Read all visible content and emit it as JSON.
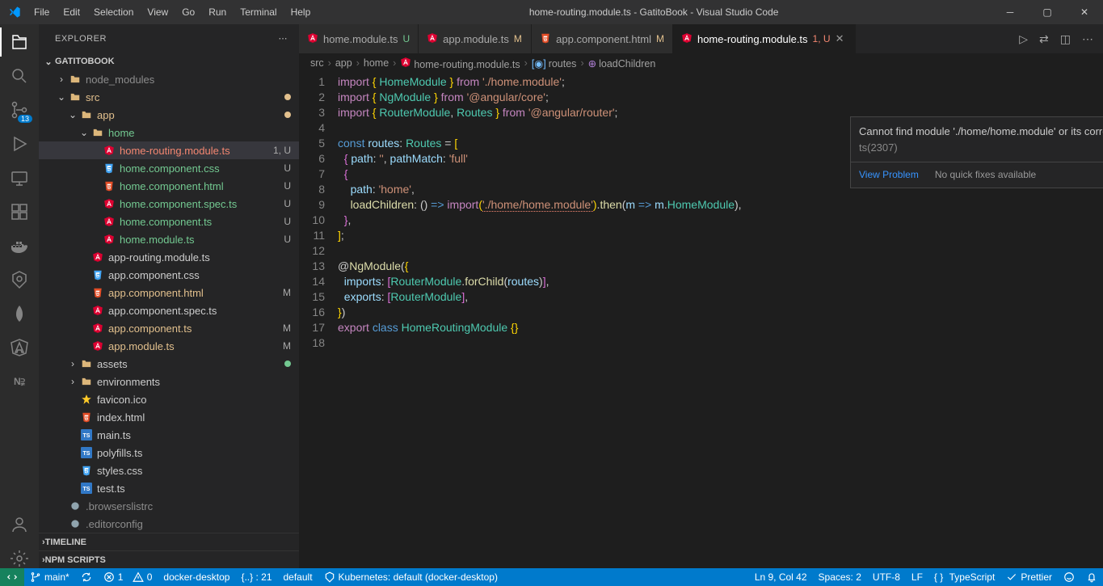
{
  "window": {
    "title": "home-routing.module.ts - GatitoBook - Visual Studio Code",
    "menu": [
      "File",
      "Edit",
      "Selection",
      "View",
      "Go",
      "Run",
      "Terminal",
      "Help"
    ]
  },
  "activity": {
    "scm_badge": "13"
  },
  "sidebar": {
    "header": "EXPLORER",
    "root": "GATITOBOOK",
    "footer1": "TIMELINE",
    "footer2": "NPM SCRIPTS",
    "tree": [
      {
        "indent": 1,
        "twisty": ">",
        "folder": true,
        "label": "node_modules",
        "class": "c-ign"
      },
      {
        "indent": 1,
        "twisty": "v",
        "folder": true,
        "label": "src",
        "class": "c-mod",
        "dot": "#e2c08d"
      },
      {
        "indent": 2,
        "twisty": "v",
        "folder": true,
        "label": "app",
        "class": "c-mod",
        "dot": "#e2c08d"
      },
      {
        "indent": 3,
        "twisty": "v",
        "folder": true,
        "label": "home",
        "class": "c-unt"
      },
      {
        "indent": 4,
        "icon": "ang",
        "label": "home-routing.module.ts",
        "class": "c-err",
        "badge": "1, U",
        "selected": true
      },
      {
        "indent": 4,
        "icon": "css",
        "label": "home.component.css",
        "class": "c-unt",
        "badge": "U"
      },
      {
        "indent": 4,
        "icon": "html",
        "label": "home.component.html",
        "class": "c-unt",
        "badge": "U"
      },
      {
        "indent": 4,
        "icon": "ang",
        "label": "home.component.spec.ts",
        "class": "c-unt",
        "badge": "U"
      },
      {
        "indent": 4,
        "icon": "ang",
        "label": "home.component.ts",
        "class": "c-unt",
        "badge": "U"
      },
      {
        "indent": 4,
        "icon": "ang",
        "label": "home.module.ts",
        "class": "c-unt",
        "badge": "U"
      },
      {
        "indent": 3,
        "icon": "ang",
        "label": "app-routing.module.ts"
      },
      {
        "indent": 3,
        "icon": "css",
        "label": "app.component.css"
      },
      {
        "indent": 3,
        "icon": "html",
        "label": "app.component.html",
        "class": "c-mod",
        "badge": "M"
      },
      {
        "indent": 3,
        "icon": "ang",
        "label": "app.component.spec.ts"
      },
      {
        "indent": 3,
        "icon": "ang",
        "label": "app.component.ts",
        "class": "c-mod",
        "badge": "M"
      },
      {
        "indent": 3,
        "icon": "ang",
        "label": "app.module.ts",
        "class": "c-mod",
        "badge": "M"
      },
      {
        "indent": 2,
        "twisty": ">",
        "folder": true,
        "label": "assets",
        "dot": "#73c991"
      },
      {
        "indent": 2,
        "twisty": ">",
        "folder": true,
        "label": "environments"
      },
      {
        "indent": 2,
        "icon": "fav",
        "label": "favicon.ico"
      },
      {
        "indent": 2,
        "icon": "html",
        "label": "index.html"
      },
      {
        "indent": 2,
        "icon": "ts",
        "label": "main.ts"
      },
      {
        "indent": 2,
        "icon": "ts",
        "label": "polyfills.ts"
      },
      {
        "indent": 2,
        "icon": "css",
        "label": "styles.css"
      },
      {
        "indent": 2,
        "icon": "ts",
        "label": "test.ts"
      },
      {
        "indent": 1,
        "icon": "cfg",
        "label": ".browserslistrc",
        "class": "c-ign"
      },
      {
        "indent": 1,
        "icon": "cfg",
        "label": ".editorconfig",
        "class": "c-ign"
      }
    ]
  },
  "tabs": [
    {
      "icon": "ang",
      "label": "home.module.ts",
      "suffix": "U",
      "suffixClass": "c-unt"
    },
    {
      "icon": "ang",
      "label": "app.module.ts",
      "suffix": "M",
      "suffixClass": "c-mod"
    },
    {
      "icon": "html",
      "label": "app.component.html",
      "suffix": "M",
      "suffixClass": "c-mod"
    },
    {
      "icon": "ang",
      "label": "home-routing.module.ts",
      "suffix": "1, U",
      "suffixClass": "c-err",
      "active": true,
      "close": true
    }
  ],
  "breadcrumbs": [
    "src",
    "app",
    "home",
    "home-routing.module.ts",
    "routes",
    "loadChildren"
  ],
  "hover": {
    "message": "Cannot find module './home/home.module' or its corresponding type declarations.",
    "code": "ts(2307)",
    "link": "View Problem",
    "noquick": "No quick fixes available"
  },
  "code": {
    "lines": [
      "1",
      "2",
      "3",
      "4",
      "5",
      "6",
      "7",
      "8",
      "9",
      "10",
      "11",
      "12",
      "13",
      "14",
      "15",
      "16",
      "17",
      "18"
    ]
  },
  "status": {
    "remote": "",
    "branch": "main*",
    "sync": "",
    "errors": "1",
    "warnings": "0",
    "docker": "docker-desktop",
    "json": "{..} : 21",
    "profile": "default",
    "k8s": "Kubernetes: default (docker-desktop)",
    "lncol": "Ln 9, Col 42",
    "spaces": "Spaces: 2",
    "enc": "UTF-8",
    "eol": "LF",
    "lang": "TypeScript",
    "prettier": "Prettier",
    "bell": ""
  }
}
